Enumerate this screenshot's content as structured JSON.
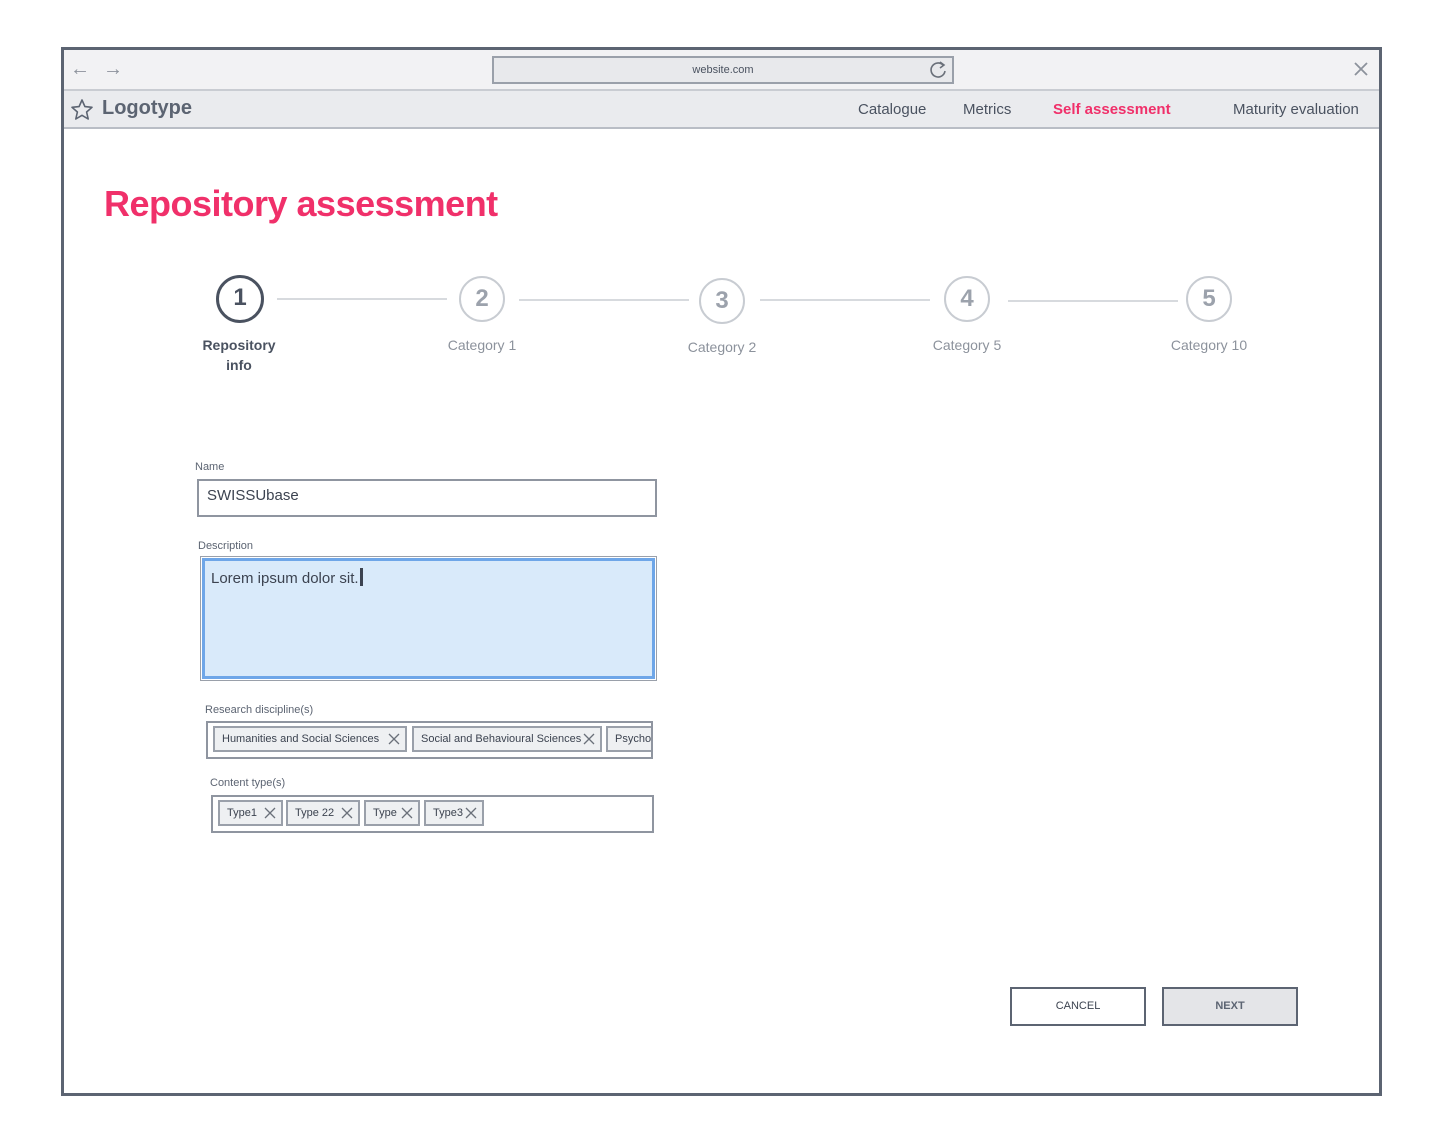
{
  "browser": {
    "url": "website.com"
  },
  "header": {
    "logo": "Logotype",
    "nav": [
      {
        "label": "Catalogue"
      },
      {
        "label": "Metrics"
      },
      {
        "label": "Self assessment"
      },
      {
        "label": "Maturity evaluation"
      }
    ],
    "active_nav": "Self assessment"
  },
  "page": {
    "title": "Repository assessment"
  },
  "stepper": {
    "steps": [
      {
        "number": "1",
        "label": "Repository info"
      },
      {
        "number": "2",
        "label": "Category 1"
      },
      {
        "number": "3",
        "label": "Category 2"
      },
      {
        "number": "4",
        "label": "Category 5"
      },
      {
        "number": "5",
        "label": "Category 10"
      }
    ],
    "current_step": 1
  },
  "form": {
    "name": {
      "label": "Name",
      "value": "SWISSUbase"
    },
    "description": {
      "label": "Description",
      "value": "Lorem ipsum dolor sit."
    },
    "disciplines": {
      "label": "Research discipline(s)",
      "tags": [
        "Humanities and Social Sciences",
        "Social and Behavioural Sciences",
        "Psycho"
      ]
    },
    "content_types": {
      "label": "Content type(s)",
      "tags": [
        "Type1",
        "Type 22",
        "Type",
        "Type3"
      ]
    }
  },
  "actions": {
    "cancel": "CANCEL",
    "next": "NEXT"
  },
  "colors": {
    "accent": "#f0306a",
    "text": "#4a5260",
    "focus_fill": "#d9eafa",
    "focus_border": "#6ea6e8"
  }
}
